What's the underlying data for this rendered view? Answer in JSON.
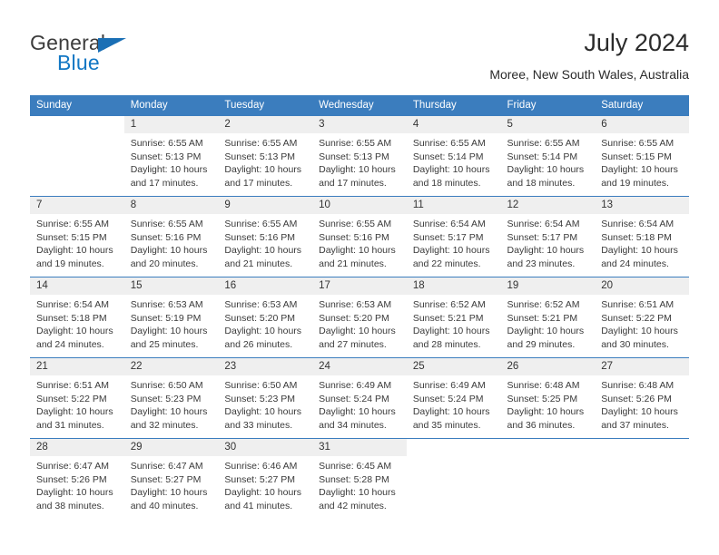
{
  "brand": {
    "line1": "General",
    "line2": "Blue",
    "accent_color": "#1277c4",
    "triangle_color": "#1a6fb5"
  },
  "header": {
    "title": "July 2024",
    "location": "Moree, New South Wales, Australia"
  },
  "theme": {
    "header_band": "#3b7dbe",
    "daynum_band": "#efefef",
    "text": "#2b2b2b"
  },
  "weekday_headers": [
    "Sunday",
    "Monday",
    "Tuesday",
    "Wednesday",
    "Thursday",
    "Friday",
    "Saturday"
  ],
  "labels": {
    "sunrise_prefix": "Sunrise: ",
    "sunset_prefix": "Sunset: ",
    "daylight_prefix": "Daylight: "
  },
  "weeks": [
    [
      {
        "empty": true
      },
      {
        "day": "1",
        "sunrise": "Sunrise: 6:55 AM",
        "sunset": "Sunset: 5:13 PM",
        "daylight": "Daylight: 10 hours and 17 minutes."
      },
      {
        "day": "2",
        "sunrise": "Sunrise: 6:55 AM",
        "sunset": "Sunset: 5:13 PM",
        "daylight": "Daylight: 10 hours and 17 minutes."
      },
      {
        "day": "3",
        "sunrise": "Sunrise: 6:55 AM",
        "sunset": "Sunset: 5:13 PM",
        "daylight": "Daylight: 10 hours and 17 minutes."
      },
      {
        "day": "4",
        "sunrise": "Sunrise: 6:55 AM",
        "sunset": "Sunset: 5:14 PM",
        "daylight": "Daylight: 10 hours and 18 minutes."
      },
      {
        "day": "5",
        "sunrise": "Sunrise: 6:55 AM",
        "sunset": "Sunset: 5:14 PM",
        "daylight": "Daylight: 10 hours and 18 minutes."
      },
      {
        "day": "6",
        "sunrise": "Sunrise: 6:55 AM",
        "sunset": "Sunset: 5:15 PM",
        "daylight": "Daylight: 10 hours and 19 minutes."
      }
    ],
    [
      {
        "day": "7",
        "sunrise": "Sunrise: 6:55 AM",
        "sunset": "Sunset: 5:15 PM",
        "daylight": "Daylight: 10 hours and 19 minutes."
      },
      {
        "day": "8",
        "sunrise": "Sunrise: 6:55 AM",
        "sunset": "Sunset: 5:16 PM",
        "daylight": "Daylight: 10 hours and 20 minutes."
      },
      {
        "day": "9",
        "sunrise": "Sunrise: 6:55 AM",
        "sunset": "Sunset: 5:16 PM",
        "daylight": "Daylight: 10 hours and 21 minutes."
      },
      {
        "day": "10",
        "sunrise": "Sunrise: 6:55 AM",
        "sunset": "Sunset: 5:16 PM",
        "daylight": "Daylight: 10 hours and 21 minutes."
      },
      {
        "day": "11",
        "sunrise": "Sunrise: 6:54 AM",
        "sunset": "Sunset: 5:17 PM",
        "daylight": "Daylight: 10 hours and 22 minutes."
      },
      {
        "day": "12",
        "sunrise": "Sunrise: 6:54 AM",
        "sunset": "Sunset: 5:17 PM",
        "daylight": "Daylight: 10 hours and 23 minutes."
      },
      {
        "day": "13",
        "sunrise": "Sunrise: 6:54 AM",
        "sunset": "Sunset: 5:18 PM",
        "daylight": "Daylight: 10 hours and 24 minutes."
      }
    ],
    [
      {
        "day": "14",
        "sunrise": "Sunrise: 6:54 AM",
        "sunset": "Sunset: 5:18 PM",
        "daylight": "Daylight: 10 hours and 24 minutes."
      },
      {
        "day": "15",
        "sunrise": "Sunrise: 6:53 AM",
        "sunset": "Sunset: 5:19 PM",
        "daylight": "Daylight: 10 hours and 25 minutes."
      },
      {
        "day": "16",
        "sunrise": "Sunrise: 6:53 AM",
        "sunset": "Sunset: 5:20 PM",
        "daylight": "Daylight: 10 hours and 26 minutes."
      },
      {
        "day": "17",
        "sunrise": "Sunrise: 6:53 AM",
        "sunset": "Sunset: 5:20 PM",
        "daylight": "Daylight: 10 hours and 27 minutes."
      },
      {
        "day": "18",
        "sunrise": "Sunrise: 6:52 AM",
        "sunset": "Sunset: 5:21 PM",
        "daylight": "Daylight: 10 hours and 28 minutes."
      },
      {
        "day": "19",
        "sunrise": "Sunrise: 6:52 AM",
        "sunset": "Sunset: 5:21 PM",
        "daylight": "Daylight: 10 hours and 29 minutes."
      },
      {
        "day": "20",
        "sunrise": "Sunrise: 6:51 AM",
        "sunset": "Sunset: 5:22 PM",
        "daylight": "Daylight: 10 hours and 30 minutes."
      }
    ],
    [
      {
        "day": "21",
        "sunrise": "Sunrise: 6:51 AM",
        "sunset": "Sunset: 5:22 PM",
        "daylight": "Daylight: 10 hours and 31 minutes."
      },
      {
        "day": "22",
        "sunrise": "Sunrise: 6:50 AM",
        "sunset": "Sunset: 5:23 PM",
        "daylight": "Daylight: 10 hours and 32 minutes."
      },
      {
        "day": "23",
        "sunrise": "Sunrise: 6:50 AM",
        "sunset": "Sunset: 5:23 PM",
        "daylight": "Daylight: 10 hours and 33 minutes."
      },
      {
        "day": "24",
        "sunrise": "Sunrise: 6:49 AM",
        "sunset": "Sunset: 5:24 PM",
        "daylight": "Daylight: 10 hours and 34 minutes."
      },
      {
        "day": "25",
        "sunrise": "Sunrise: 6:49 AM",
        "sunset": "Sunset: 5:24 PM",
        "daylight": "Daylight: 10 hours and 35 minutes."
      },
      {
        "day": "26",
        "sunrise": "Sunrise: 6:48 AM",
        "sunset": "Sunset: 5:25 PM",
        "daylight": "Daylight: 10 hours and 36 minutes."
      },
      {
        "day": "27",
        "sunrise": "Sunrise: 6:48 AM",
        "sunset": "Sunset: 5:26 PM",
        "daylight": "Daylight: 10 hours and 37 minutes."
      }
    ],
    [
      {
        "day": "28",
        "sunrise": "Sunrise: 6:47 AM",
        "sunset": "Sunset: 5:26 PM",
        "daylight": "Daylight: 10 hours and 38 minutes."
      },
      {
        "day": "29",
        "sunrise": "Sunrise: 6:47 AM",
        "sunset": "Sunset: 5:27 PM",
        "daylight": "Daylight: 10 hours and 40 minutes."
      },
      {
        "day": "30",
        "sunrise": "Sunrise: 6:46 AM",
        "sunset": "Sunset: 5:27 PM",
        "daylight": "Daylight: 10 hours and 41 minutes."
      },
      {
        "day": "31",
        "sunrise": "Sunrise: 6:45 AM",
        "sunset": "Sunset: 5:28 PM",
        "daylight": "Daylight: 10 hours and 42 minutes."
      },
      {
        "empty": true
      },
      {
        "empty": true
      },
      {
        "empty": true
      }
    ]
  ]
}
